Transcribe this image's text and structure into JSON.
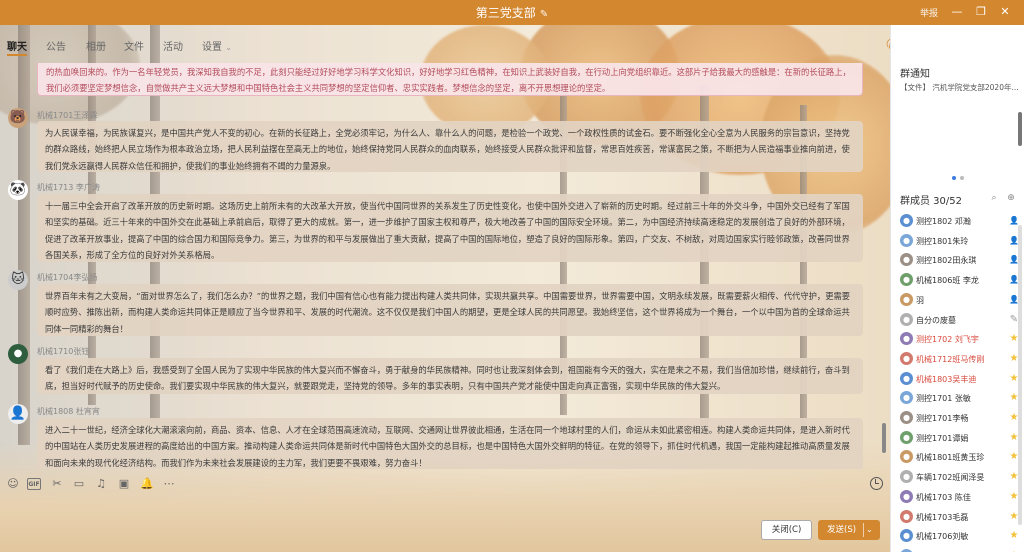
{
  "window": {
    "title": "第三党支部",
    "report": "举报",
    "controls": [
      "minimize-icon",
      "restore-icon",
      "close-icon"
    ]
  },
  "tabs": [
    "聊天",
    "公告",
    "相册",
    "文件",
    "活动",
    "设置"
  ],
  "messages": [
    {
      "text": "的热血唤回来的。作为一名年轻党员，我深知我自我的不足，此刻只能经过好好地学习科学文化知识，好好地学习红色精神，在知识上武装好自我，在行动上向党组织靠近。这部片子给我最大的感触是：在新的长征路上，我们必须要坚定梦想信念，自觉做共产主义远大梦想和中国特色社会主义共同梦想的坚定信仰者、忠实实践者。梦想信念的坚定，离不开思想理论的坚定。"
    },
    {
      "sender": "机械1701王泽霖",
      "text": "为人民谋幸福，为民族谋复兴，是中国共产党人不变的初心。在新的长征路上，全党必须牢记，为什么人、靠什么人的问题，是检验一个政党、一个政权性质的试金石。要不断强化全心全意为人民服务的宗旨意识，坚持党的群众路线，始终把人民立场作为根本政治立场，把人民利益摆在至高无上的地位，始终保持党同人民群众的血肉联系，始终接受人民群众批评和监督，常思百姓疾苦，常谋富民之策，不断把为人民造福事业推向前进，使我们党永远赢得人民群众信任和拥护，使我们的事业始终拥有不竭的力量源泉。"
    },
    {
      "sender": "机械1713 李广涛",
      "text": "十一届三中全会开启了改革开放的历史新时期。这场历史上前所未有的大改革大开放，使当代中国同世界的关系发生了历史性变化，也使中国外交进入了崭新的历史时期。经过前三十年的外交斗争，中国外交已经有了军国和坚实的基础。近三十年来的中国外交在此基础上承前启后，取得了更大的成就。第一，进一步维护了国家主权和尊严，极大地改善了中国的国际安全环境。第二，为中国经济持续高速稳定的发展创造了良好的外部环境，促进了改革开放事业，提高了中国的综合国力和国际竞争力。第三，为世界的和平与发展做出了重大贡献，提高了中国的国际地位，塑造了良好的国际形象。第四，广交友、不树敌，对周边国家实行睦邻政策，改善同世界各国关系，形成了全方位的良好对外关系格局。"
    },
    {
      "sender": "机械1704李弘扬",
      "text": "世界百年未有之大变局，“面对世界怎么了，我们怎么办？”的世界之题，我们中国有信心也有能力提出构建人类共同体，实现共赢共享。中国需要世界，世界需要中国，文明永续发展，既需要薪火相传、代代守护，更需要顺时应势、推陈出新，而构建人类命运共同体正是顺应了当今世界和平、发展的时代潮流。这不仅仅是我们中国人的期望，更是全球人民的共同愿望。我始终坚信，这个世界将成为一个舞台，一个以中国为首的全球命运共同体一同精彩的舞台！"
    },
    {
      "sender": "机械1710张钰",
      "text": "看了《我们走在大路上》后，我感受到了全国人民为了实现中华民族的伟大复兴而不懈奋斗，勇于献身的华民族精神。同时也让我深刻体会到，祖国能有今天的强大，实在是来之不易，我们当倍加珍惜，继续前行，奋斗到底，担当好时代赋予的历史使命。我们要实现中华民族的伟大复兴，就要跟党走，坚持党的领导。多年的事实表明，只有中国共产党才能使中国走向真正富强，实现中华民族的伟大复兴。"
    },
    {
      "sender": "机械1808 杜宵宵",
      "text": "进入二十一世纪，经济全球化大潮滚滚向前，商品、资本、信息、人才在全球范围高速流动，互联网、交通网让世界彼此相通，生活在同一个地球村里的人们，命运从未如此紧密相连。构建人类命运共同体，是进入新时代的中国站在人类历史发展进程的高度给出的中国方案。推动构建人类命运共同体是新时代中国特色大国外交的总目标，也是中国特色大国外交鲜明的特征。在党的领导下，抓住时代机遇，我国一定能构建起推动高质量发展和面向未来的现代化经济结构。而我们作为未来社会发展建设的主力军，我们更要不畏艰难，努力奋斗！"
    }
  ],
  "buttons": {
    "close": "关闭(C)",
    "send": "发送(S)"
  },
  "notice": {
    "title": "群通知",
    "text": "【文件】 汽机学院党支部2020年..."
  },
  "members": {
    "title": "群成员 30/52",
    "list": [
      {
        "name": "测控1802 邓瀚",
        "red": false,
        "badge": "person"
      },
      {
        "name": "测控1801朱玲",
        "red": false,
        "badge": "person"
      },
      {
        "name": "测控1802田永琪",
        "red": false,
        "badge": "person"
      },
      {
        "name": "机械1806班 李龙",
        "red": false,
        "badge": "person"
      },
      {
        "name": "羽",
        "red": false,
        "badge": "person"
      },
      {
        "name": "自分の废墓",
        "red": false,
        "badge": "edit-person"
      },
      {
        "name": "测控1702 刘飞宇",
        "red": true,
        "badge": "star"
      },
      {
        "name": "机械1712班马传刚",
        "red": true,
        "badge": "star"
      },
      {
        "name": "机械1803吴丰迪",
        "red": true,
        "badge": "star"
      },
      {
        "name": "测控1701 张敏",
        "red": false,
        "badge": "star"
      },
      {
        "name": "测控1701李畅",
        "red": false,
        "badge": "star"
      },
      {
        "name": "测控1701谭娟",
        "red": false,
        "badge": "star"
      },
      {
        "name": "机械1801班黄玉珍",
        "red": false,
        "badge": "star"
      },
      {
        "name": "车辆1702班闻泽旻",
        "red": false,
        "badge": "star"
      },
      {
        "name": "机械1703 陈佳",
        "red": false,
        "badge": "star"
      },
      {
        "name": "机械1703毛磊",
        "red": false,
        "badge": "star"
      },
      {
        "name": "机械1706刘敏",
        "red": false,
        "badge": "star"
      },
      {
        "name": "机械1707姬瑞玄",
        "red": false,
        "badge": "star"
      }
    ]
  },
  "colors": {
    "accent": "#d3872f",
    "bubble": "#e2d3c2",
    "red_name": "#d94a3c"
  }
}
